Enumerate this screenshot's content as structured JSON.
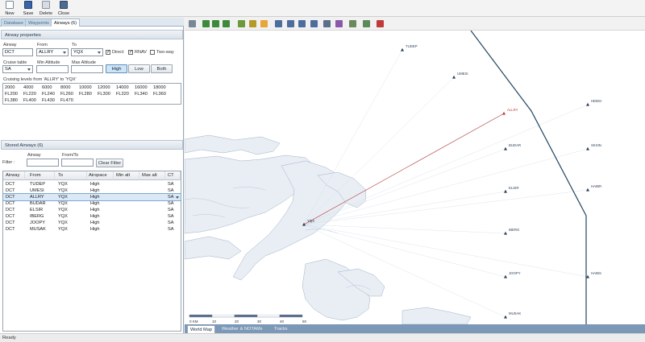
{
  "toolbar": {
    "new_label": "New",
    "save_label": "Save",
    "delete_label": "Delete",
    "close_label": "Close"
  },
  "left_tabs": [
    "Database",
    "Waypoints",
    "Airways (6)"
  ],
  "airway_properties": {
    "header": "Airway properties",
    "airway_label": "Airway",
    "airway_value": "DCT",
    "from_label": "From",
    "from_value": "ALLRY",
    "to_label": "To",
    "to_value": "YQX",
    "direct_label": "Direct",
    "direct_checked": true,
    "rnav_label": "RNAV",
    "rnav_checked": true,
    "twoway_label": "Two-way",
    "twoway_checked": false,
    "cruise_table_label": "Cruise table",
    "cruise_table_value": "SA",
    "min_alt_label": "Min Altitude",
    "min_alt_value": "",
    "max_alt_label": "Max Altitude",
    "max_alt_value": "",
    "high_label": "High",
    "low_label": "Low",
    "both_label": "Both",
    "cruising_caption": "Cruising levels from 'ALLRY' to 'YQX'",
    "levels": [
      [
        "2000",
        "4000",
        "6000",
        "8000",
        "10000",
        "12000",
        "14000",
        "16000",
        "18000"
      ],
      [
        "FL200",
        "FL220",
        "FL240",
        "FL260",
        "FL280",
        "FL300",
        "FL320",
        "FL340",
        "FL360"
      ],
      [
        "FL380",
        "FL400",
        "FL430",
        "FL470"
      ]
    ]
  },
  "stored_airways": {
    "header": "Stored Airways (6)",
    "filter_label": "Filter :",
    "airway_filter_label": "Airway",
    "fromto_filter_label": "From/To",
    "clear_filter_label": "Clear Filter",
    "columns": [
      "Airway",
      "From",
      "To",
      "Airspace",
      "Min alt",
      "Max alt",
      "CT"
    ],
    "rows": [
      [
        "DCT",
        "TUDEP",
        "YQX",
        "High",
        "",
        "",
        "SA"
      ],
      [
        "DCT",
        "UMESI",
        "YQX",
        "High",
        "",
        "",
        "SA"
      ],
      [
        "DCT",
        "ALLRY",
        "YQX",
        "High",
        "",
        "",
        "SA"
      ],
      [
        "DCT",
        "BUDAR",
        "YQX",
        "High",
        "",
        "",
        "SA"
      ],
      [
        "DCT",
        "ELSIR",
        "YQX",
        "High",
        "",
        "",
        "SA"
      ],
      [
        "DCT",
        "IBERG",
        "YQX",
        "High",
        "",
        "",
        "SA"
      ],
      [
        "DCT",
        "JOOPY",
        "YQX",
        "High",
        "",
        "",
        "SA"
      ],
      [
        "DCT",
        "MUSAK",
        "YQX",
        "High",
        "",
        "",
        "SA"
      ]
    ],
    "selected_row": 2
  },
  "map": {
    "toolbar_icons": [
      "map-select-icon",
      "zoom-in-icon",
      "zoom-out-icon",
      "zoom-fit-icon",
      "settings-icon",
      "airport-icon",
      "highlight-icon",
      "ndb-icon",
      "vor-icon",
      "fix-icon",
      "rwy-icon",
      "ils-icon",
      "airway-icon",
      "layers-icon",
      "route-icon",
      "link-icon"
    ],
    "waypoints": [
      {
        "name": "TUDEP",
        "red": false
      },
      {
        "name": "UMESI",
        "red": false
      },
      {
        "name": "ALLRY",
        "red": true
      },
      {
        "name": "HEBSI",
        "red": false
      },
      {
        "name": "BUDAR",
        "red": false
      },
      {
        "name": "SKSIN",
        "red": false
      },
      {
        "name": "ELSIR",
        "red": false
      },
      {
        "name": "HAIBR",
        "red": false
      },
      {
        "name": "IBERG",
        "red": false
      },
      {
        "name": "JOOPY",
        "red": false
      },
      {
        "name": "HAIBS",
        "red": false
      },
      {
        "name": "MUSAK",
        "red": false
      },
      {
        "name": "NOVLE",
        "red": false
      },
      {
        "name": "YQX",
        "red": false
      }
    ],
    "scale_labels": [
      "0 KM",
      "10",
      "20",
      "30",
      "40",
      "50"
    ],
    "bottom_tabs": [
      "World Map",
      "Weather & NOTAMs",
      "Tracks"
    ]
  },
  "status": "Ready",
  "colors": {
    "accent": "#5c8fbe",
    "route_line": "#b23a3a",
    "fir_boundary": "#1f4660",
    "map_tab_bar": "#7b98b7"
  }
}
